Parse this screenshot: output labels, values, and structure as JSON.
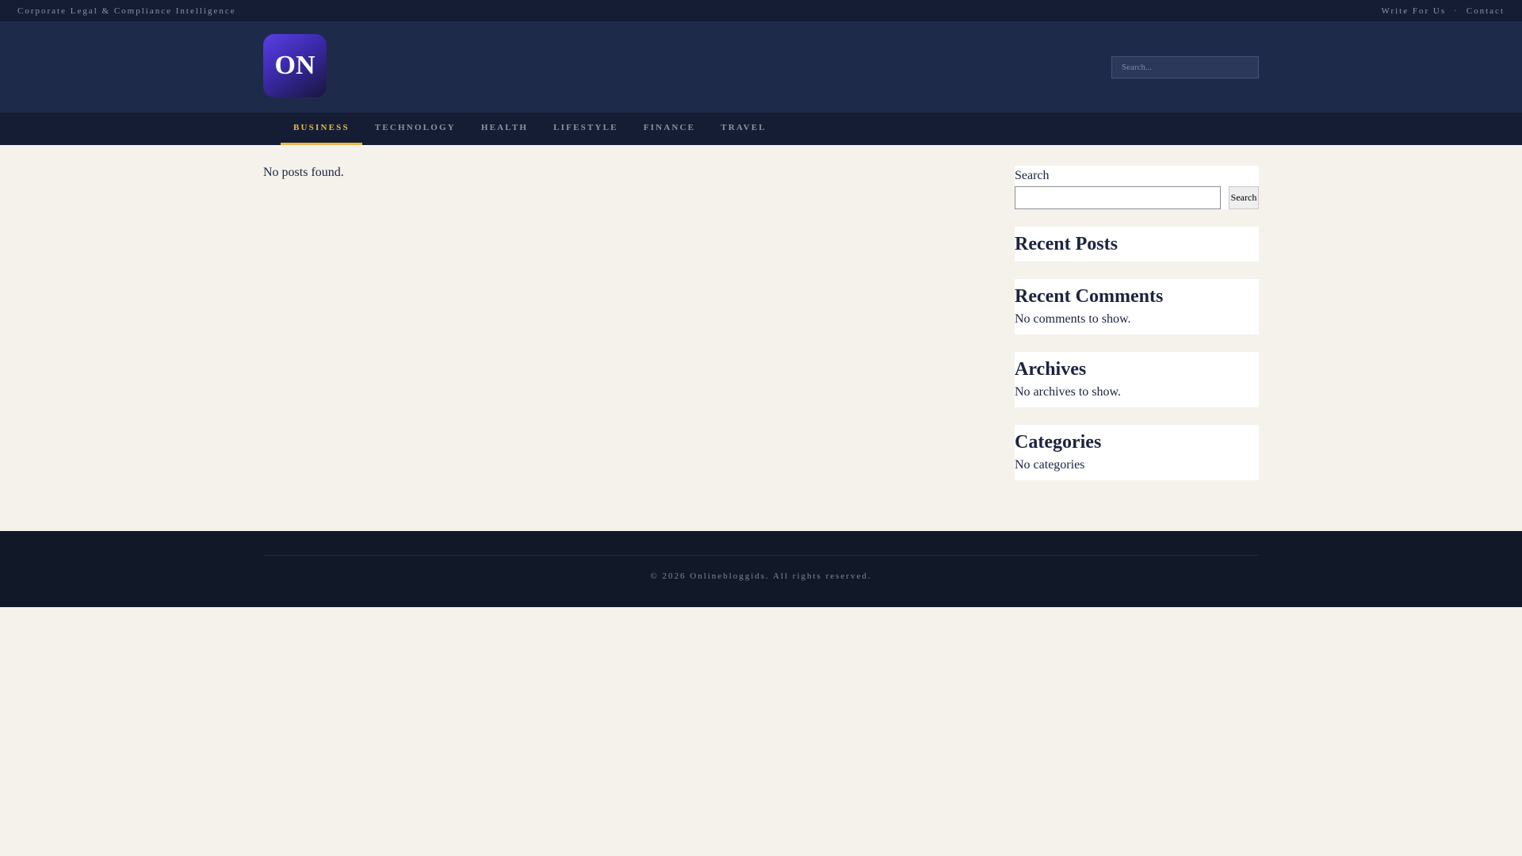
{
  "topbar": {
    "tagline": "Corporate Legal & Compliance Intelligence",
    "links": [
      {
        "label": "Write For Us"
      },
      {
        "label": "Contact"
      }
    ],
    "separator": "·"
  },
  "header": {
    "logo_text": "ON",
    "search_placeholder": "Search..."
  },
  "nav": {
    "items": [
      {
        "label": "BUSINESS",
        "active": true
      },
      {
        "label": "TECHNOLOGY"
      },
      {
        "label": "HEALTH"
      },
      {
        "label": "LIFESTYLE"
      },
      {
        "label": "FINANCE"
      },
      {
        "label": "TRAVEL"
      }
    ]
  },
  "main": {
    "empty_message": "No posts found."
  },
  "sidebar": {
    "search": {
      "label": "Search",
      "button_label": "Search"
    },
    "recent_posts": {
      "title": "Recent Posts"
    },
    "recent_comments": {
      "title": "Recent Comments",
      "empty": "No comments to show."
    },
    "archives": {
      "title": "Archives",
      "empty": "No archives to show."
    },
    "categories": {
      "title": "Categories",
      "empty": "No categories"
    }
  },
  "footer": {
    "copyright": "© 2026 Onlinebloggids. All rights reserved."
  },
  "colors": {
    "topbar_bg": "#141d33",
    "header_bg": "#1e2a4a",
    "accent": "#e8b84a",
    "page_bg": "#f5f2ec",
    "footer_bg": "#111827"
  }
}
